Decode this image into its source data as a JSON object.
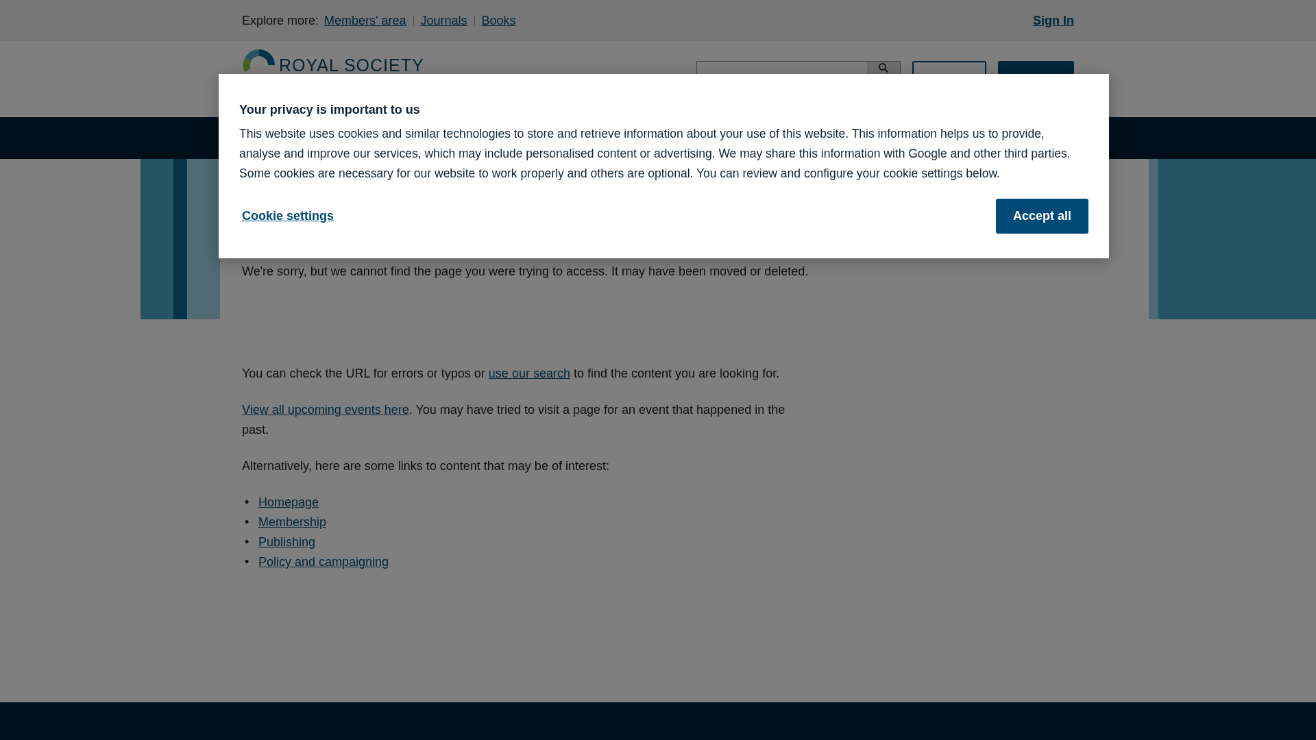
{
  "top_bar": {
    "label": "Explore more:",
    "links": [
      "Members' area",
      "Journals",
      "Books"
    ],
    "sign_in": "Sign In"
  },
  "header": {
    "logo_text": "ROYAL SOCIETY"
  },
  "content": {
    "intro": "We're sorry, but we cannot find the page you were trying to access. It may have been moved or deleted.",
    "paragraphs": [
      {
        "before": "You can check the URL for errors or typos or",
        "link": "use our search",
        "after": "to find the content you are looking for."
      },
      {
        "link": "View all upcoming events here",
        "after": ". You may have tried to visit a page for an event that happened in the past."
      },
      {
        "before": "Alternatively, here are some links to content that may be of interest:"
      }
    ],
    "links": [
      {
        "marker": "•",
        "text": "Homepage"
      },
      {
        "marker": "•",
        "text": "Membership"
      },
      {
        "marker": "•",
        "text": "Publishing"
      },
      {
        "marker": "•",
        "text": "Policy and campaigning"
      }
    ]
  },
  "cookie_dialog": {
    "title": "Your privacy is important to us",
    "text": "This website uses cookies and similar technologies to store and retrieve information about your use of this website. This information helps us to provide, analyse and improve our services, which may include personalised content or advertising. We may share this information with Google and other third parties. Some cookies are necessary for our website to work properly and others are optional. You can review and configure your cookie settings below.",
    "settings_link": "Cookie settings",
    "accept_button": "Accept all"
  }
}
